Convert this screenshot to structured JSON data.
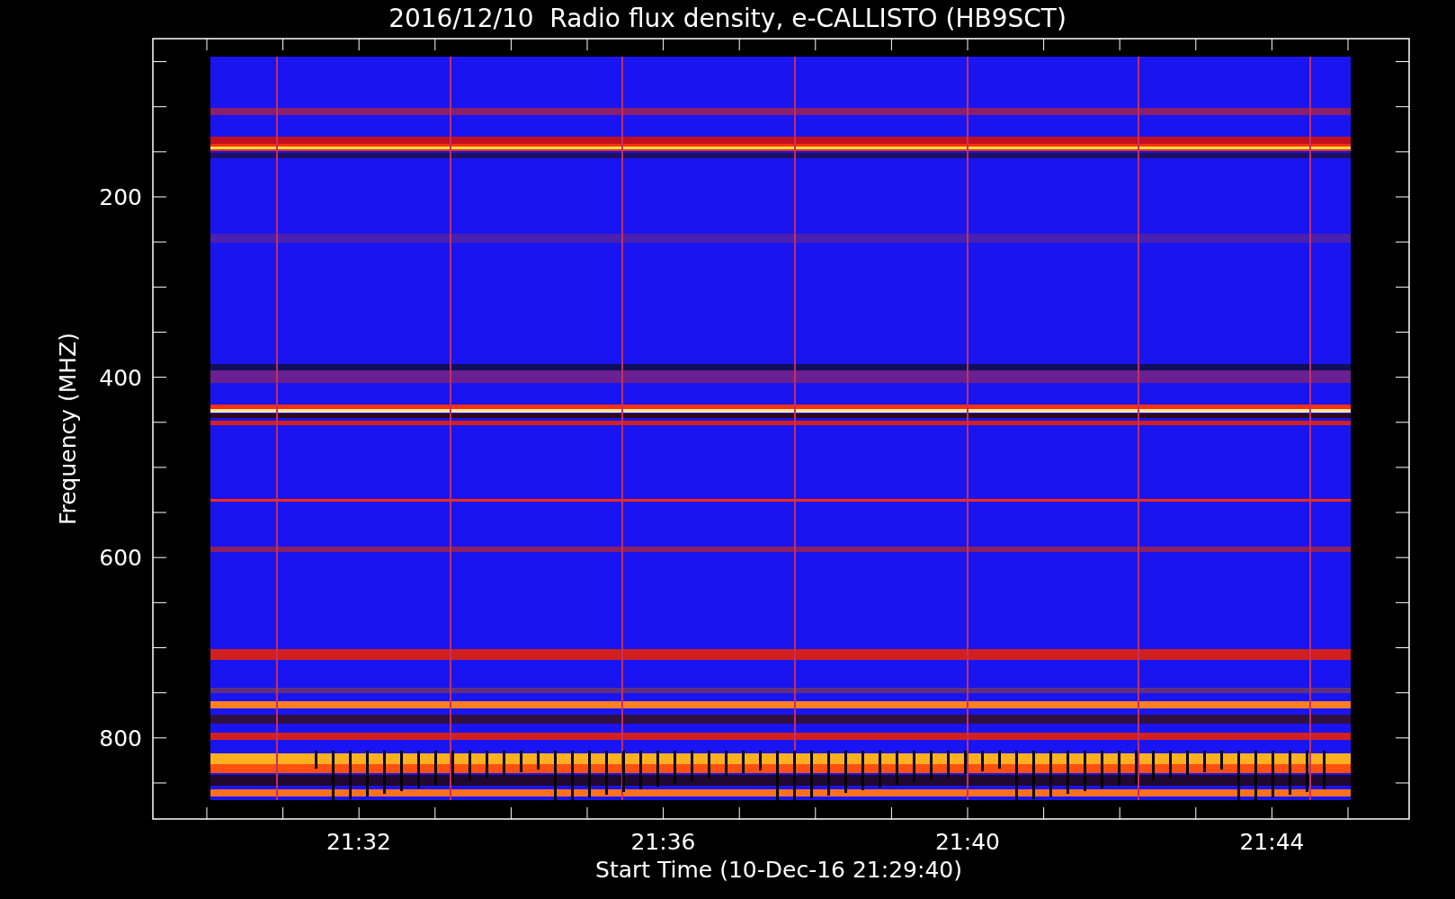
{
  "title": "2016/12/10  Radio flux density, e-CALLISTO (HB9SCT)",
  "y_axis": {
    "label": "Frequency (MHZ)",
    "ticks": [
      "200",
      "400",
      "600",
      "800"
    ]
  },
  "x_axis": {
    "label": "Start Time (10-Dec-16 21:29:40)",
    "ticks": [
      "21:32",
      "21:36",
      "21:40",
      "21:44"
    ]
  }
}
